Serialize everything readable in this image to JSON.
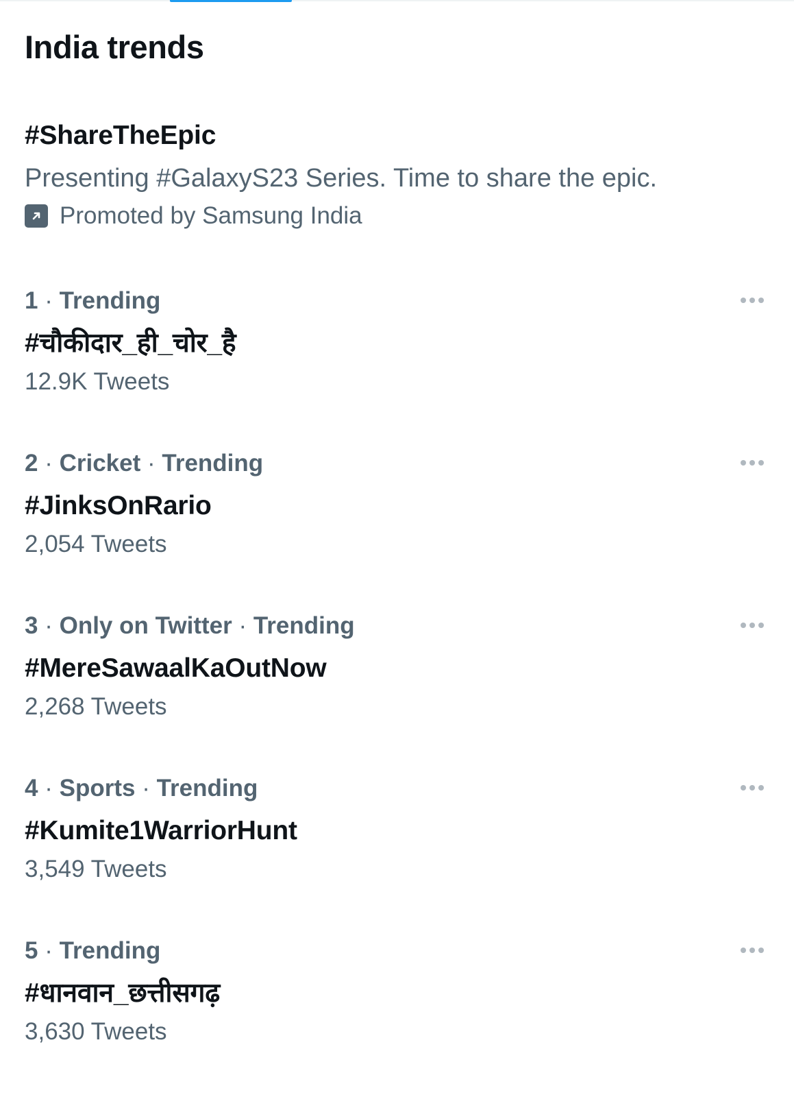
{
  "header": {
    "title": "India trends"
  },
  "promoted": {
    "hashtag": "#ShareTheEpic",
    "description": "Presenting #GalaxyS23 Series. Time to share the epic.",
    "promoted_by": "Promoted by Samsung India",
    "icon": "promoted-arrow-icon"
  },
  "trends": [
    {
      "rank": "1",
      "category": "",
      "context": "Trending",
      "hashtag": "#चौकीदार_ही_चोर_है",
      "tweet_count": "12.9K Tweets"
    },
    {
      "rank": "2",
      "category": "Cricket",
      "context": "Trending",
      "hashtag": "#JinksOnRario",
      "tweet_count": "2,054 Tweets"
    },
    {
      "rank": "3",
      "category": "Only on Twitter",
      "context": "Trending",
      "hashtag": "#MereSawaalKaOutNow",
      "tweet_count": "2,268 Tweets"
    },
    {
      "rank": "4",
      "category": "Sports",
      "context": "Trending",
      "hashtag": "#Kumite1WarriorHunt",
      "tweet_count": "3,549 Tweets"
    },
    {
      "rank": "5",
      "category": "",
      "context": "Trending",
      "hashtag": "#धानवान_छत्तीसगढ़",
      "tweet_count": "3,630 Tweets"
    }
  ],
  "separator": "·",
  "colors": {
    "text_primary": "#0f1419",
    "text_secondary": "#536471",
    "accent": "#1d9bf0",
    "more_dots": "#b0b8bf"
  },
  "icons": {
    "more": "more-horizontal-icon"
  }
}
